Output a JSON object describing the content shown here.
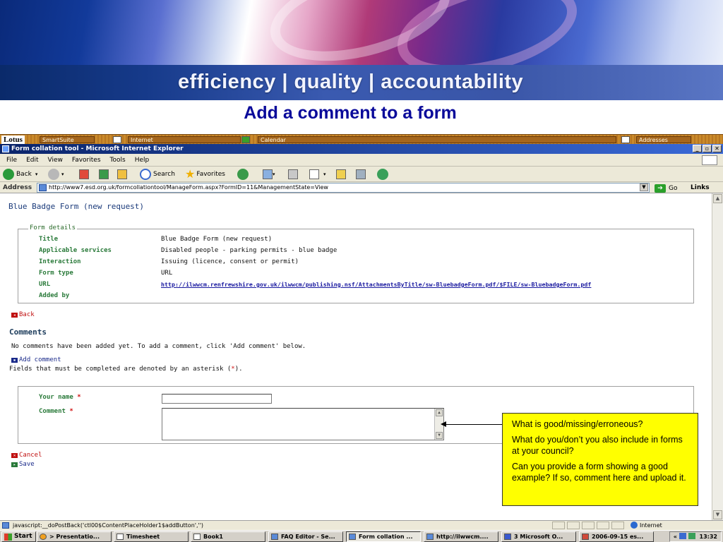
{
  "banner": {
    "slogan": "efficiency | quality | accountability"
  },
  "slide_title": "Add a comment to a form",
  "lotus_bar": {
    "logo": "Lotus",
    "items": [
      "SmartSuite",
      "Internet",
      "Calendar",
      "Addresses"
    ]
  },
  "window": {
    "title": "Form collation tool - Microsoft Internet Explorer",
    "buttons": [
      "_",
      "▫",
      "✕"
    ]
  },
  "menu": [
    "File",
    "Edit",
    "View",
    "Favorites",
    "Tools",
    "Help"
  ],
  "toolbar": {
    "back": "Back",
    "search": "Search",
    "favorites": "Favorites"
  },
  "address": {
    "label": "Address",
    "url": "http://www7.esd.org.uk/formcollationtool/ManageForm.aspx?FormID=11&ManagementState=View",
    "go": "Go",
    "links": "Links"
  },
  "page": {
    "heading": "Blue Badge Form (new request)",
    "form_details": {
      "legend": "Form details",
      "rows": [
        {
          "label": "Title",
          "value": "Blue Badge Form (new request)"
        },
        {
          "label": "Applicable services",
          "value": "Disabled people - parking permits - blue badge"
        },
        {
          "label": "Interaction",
          "value": "Issuing (licence, consent or permit)"
        },
        {
          "label": "Form type",
          "value": "URL"
        },
        {
          "label": "URL",
          "value": "http://ilwwcm.renfrewshire.gov.uk/ilwwcm/publishing.nsf/AttachmentsByTitle/sw-BluebadgeForm.pdf/$FILE/sw-BluebadgeForm.pdf"
        },
        {
          "label": "Added by",
          "value": ""
        }
      ]
    },
    "back_link": "Back",
    "comments_heading": "Comments",
    "no_comments_text": "No comments have been added yet. To add a comment, click 'Add comment' below.",
    "add_comment_link": "Add comment",
    "required_note_prefix": "Fields that must be completed are denoted by an asterisk (",
    "required_note_star": "*",
    "required_note_suffix": ").",
    "your_name_label": "Your name",
    "comment_label": "Comment",
    "asterisk": "*",
    "cancel_link": "Cancel",
    "save_link": "Save"
  },
  "callout": {
    "lines": [
      "What is good/missing/erroneous?",
      "What do you/don’t you also include in forms at your council?",
      "Can you provide a form showing a good example? If so, comment here and upload it."
    ]
  },
  "status": {
    "message": "javascript:__doPostBack('ctl00$ContentPlaceHolder1$addButton','')",
    "zone": "Internet"
  },
  "taskbar": {
    "start": "Start",
    "tasks": [
      "> Presentatio...",
      "Timesheet",
      "Book1",
      "FAQ Editor - Se...",
      "Form collation ...",
      "http://ilwwcm....",
      "3 Microsoft O...",
      "2006-09-15 es..."
    ],
    "clock": "13:32",
    "tray_chevron": "«"
  },
  "colors": {
    "label_green": "#2a7a3a",
    "link_red": "#c01010",
    "callout_yellow": "#ffff00",
    "title_blue": "#0a0a9a"
  }
}
